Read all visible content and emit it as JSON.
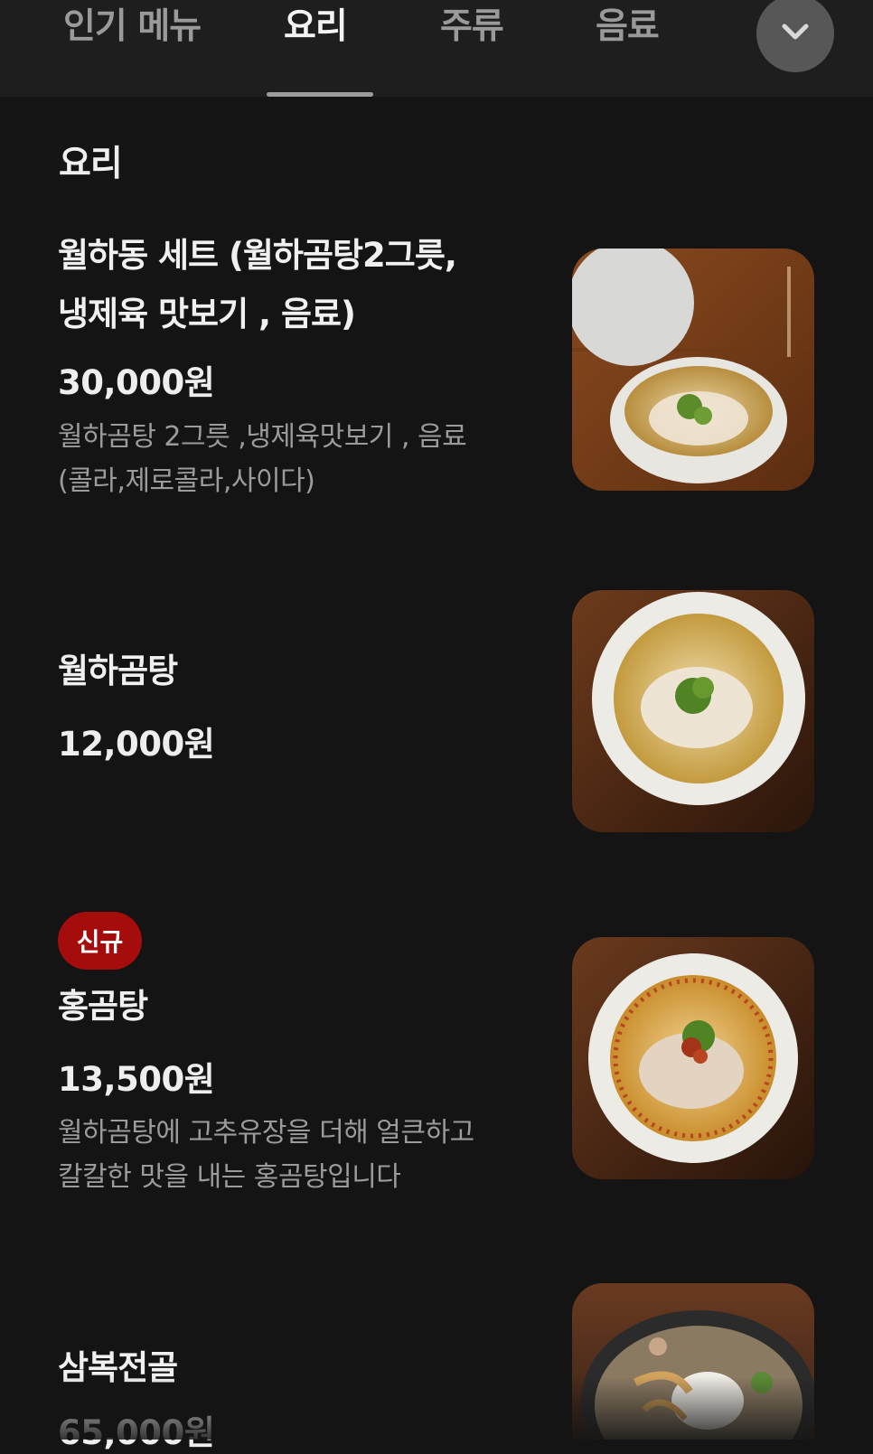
{
  "tabs": [
    {
      "label": "인기 메뉴",
      "active": false
    },
    {
      "label": "요리",
      "active": true
    },
    {
      "label": "주류",
      "active": false
    },
    {
      "label": "음료",
      "active": false
    }
  ],
  "section_title": "요리",
  "items": [
    {
      "name_line1": "월하동 세트 (월하곰탕2그릇,",
      "name_line2": "냉제육 맛보기 , 음료)",
      "price": "30,000원",
      "desc_line1": "월하곰탕 2그릇 ,냉제육맛보기 , 음료",
      "desc_line2": "(콜라,제로콜라,사이다)"
    },
    {
      "name": "월하곰탕",
      "price": "12,000원"
    },
    {
      "badge": "신규",
      "name": "홍곰탕",
      "price": "13,500원",
      "desc_line1": "월하곰탕에 고추유장을 더해 얼큰하고",
      "desc_line2": "칼칼한 맛을 내는 홍곰탕입니다"
    },
    {
      "name": "삼복전골",
      "price": "65,000원"
    }
  ],
  "colors": {
    "background": "#141414",
    "tabbar": "#1e1e1e",
    "badge": "#a50c0c"
  }
}
